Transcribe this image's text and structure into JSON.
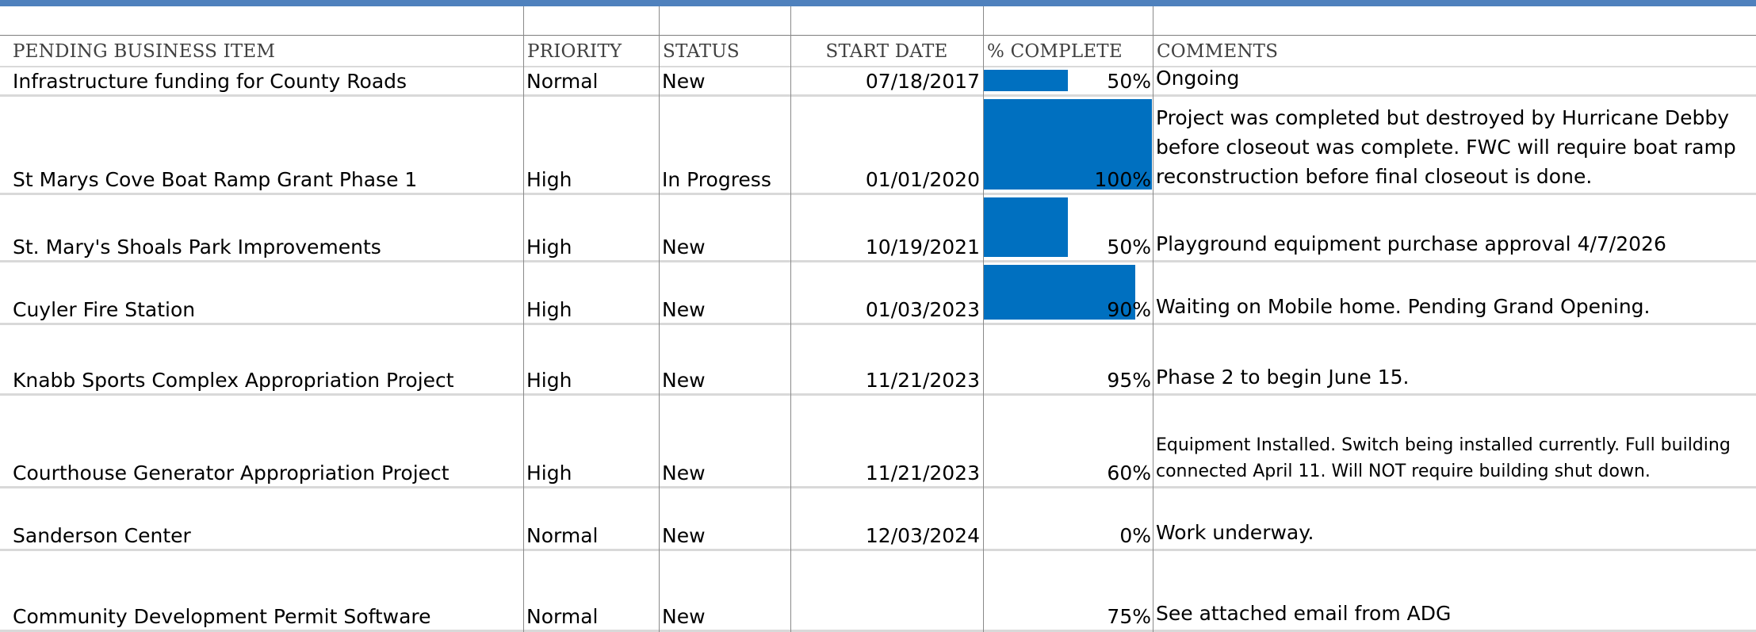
{
  "headers": {
    "item": "PENDING BUSINESS ITEM",
    "priority": "PRIORITY",
    "status": "STATUS",
    "start_date": "START DATE",
    "complete": "% COMPLETE",
    "comments": "COMMENTS"
  },
  "colors": {
    "accent_bar": "#4f81bd",
    "data_bar": "#0070c0",
    "grid": "#d9d9d9"
  },
  "rows": [
    {
      "item": "Infrastructure funding for County Roads",
      "priority": "Normal",
      "status": "New",
      "start_date": "07/18/2017",
      "complete_label": "50%",
      "bar_fraction": 0.5,
      "comments": "Ongoing"
    },
    {
      "item": "St Marys Cove Boat Ramp Grant Phase 1",
      "priority": "High",
      "status": "In Progress",
      "start_date": "01/01/2020",
      "complete_label": "100%",
      "bar_fraction": 1.0,
      "comments": "Project was completed but destroyed by Hurricane Debby before closeout was complete. FWC will require boat ramp reconstruction before final closeout is done."
    },
    {
      "item": "St. Mary's Shoals Park Improvements",
      "priority": "High",
      "status": "New",
      "start_date": "10/19/2021",
      "complete_label": "50%",
      "bar_fraction": 0.5,
      "comments": "Playground equipment purchase approval 4/7/2026"
    },
    {
      "item": "Cuyler Fire Station",
      "priority": "High",
      "status": "New",
      "start_date": "01/03/2023",
      "complete_label": "90%",
      "bar_fraction": 0.9,
      "comments": "Waiting on Mobile home. Pending Grand Opening."
    },
    {
      "item": "Knabb Sports Complex Appropriation Project",
      "priority": "High",
      "status": "New",
      "start_date": "11/21/2023",
      "complete_label": "95%",
      "bar_fraction": 0,
      "comments": "Phase 2 to begin June 15."
    },
    {
      "item": "Courthouse Generator Appropriation Project",
      "priority": "High",
      "status": "New",
      "start_date": "11/21/2023",
      "complete_label": "60%",
      "bar_fraction": 0,
      "comments": "Equipment Installed. Switch being installed currently. Full building connected April 11. Will NOT require building shut down."
    },
    {
      "item": "Sanderson Center",
      "priority": "Normal",
      "status": "New",
      "start_date": "12/03/2024",
      "complete_label": "0%",
      "bar_fraction": 0,
      "comments": "Work underway."
    },
    {
      "item": "Community Development Permit Software",
      "priority": "Normal",
      "status": "New",
      "start_date": "",
      "complete_label": "75%",
      "bar_fraction": 0,
      "comments": "See attached email from ADG"
    }
  ]
}
